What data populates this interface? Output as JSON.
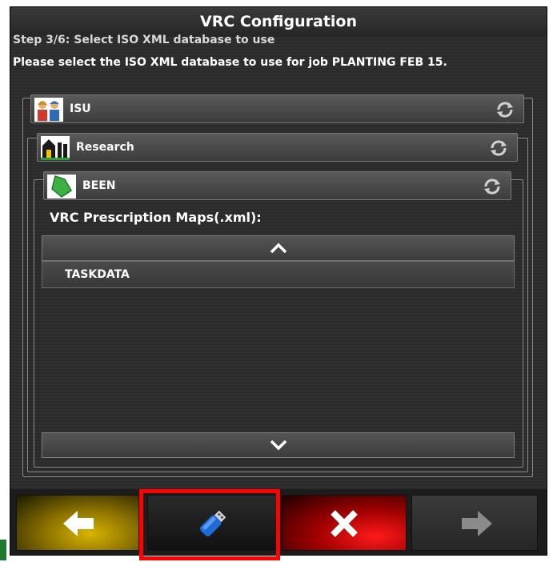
{
  "dialog": {
    "title": "VRC Configuration",
    "step": "Step 3/6: Select ISO XML database to use",
    "instruction": "Please select the ISO XML database to use for job PLANTING FEB 15."
  },
  "tree": {
    "level1": {
      "label": "ISU",
      "icon": "farmers-icon"
    },
    "level2": {
      "label": "Research",
      "icon": "farm-barn-icon"
    },
    "level3": {
      "label": "BEEN",
      "icon": "field-icon"
    }
  },
  "maps": {
    "header": "VRC Prescription Maps(.xml):",
    "items": [
      "TASKDATA"
    ]
  },
  "nav": {
    "back": "back-arrow-icon",
    "usb": "usb-drive-icon",
    "cancel": "cancel-x-icon",
    "next": "next-arrow-icon"
  },
  "colors": {
    "back": "#c8a800",
    "cancel": "#e00000",
    "highlight": "#ff0000"
  }
}
